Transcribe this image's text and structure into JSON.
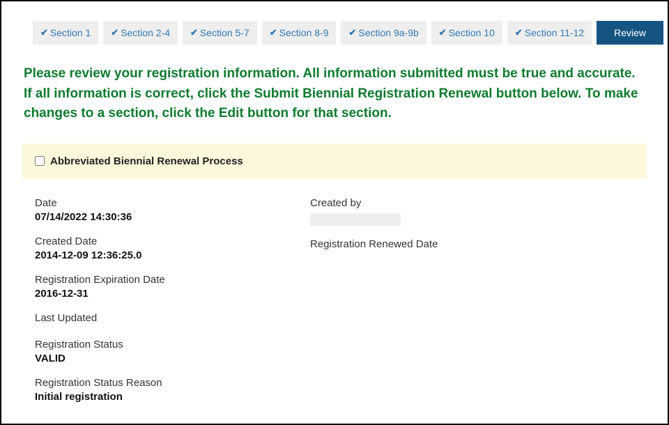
{
  "tabs": {
    "items": [
      {
        "label": "Section 1"
      },
      {
        "label": "Section 2-4"
      },
      {
        "label": "Section 5-7"
      },
      {
        "label": "Section 8-9"
      },
      {
        "label": "Section 9a-9b"
      },
      {
        "label": "Section 10"
      },
      {
        "label": "Section 11-12"
      }
    ],
    "active_label": "Review"
  },
  "instructions": "Please review your registration information. All information submitted must be true and accurate. If all information is correct, click the Submit Biennial Registration Renewal button below. To make changes to a section, click the Edit button for that section.",
  "abbreviated_label": "Abbreviated Biennial Renewal Process",
  "fields": {
    "date_label": "Date",
    "date_value": "07/14/2022 14:30:36",
    "created_by_label": "Created by",
    "created_date_label": "Created Date",
    "created_date_value": "2014-12-09 12:36:25.0",
    "renewed_date_label": "Registration Renewed Date",
    "expiration_label": "Registration Expiration Date",
    "expiration_value": "2016-12-31",
    "last_updated_label": "Last Updated",
    "status_label": "Registration Status",
    "status_value": "VALID",
    "reason_label": "Registration Status Reason",
    "reason_value": "Initial registration"
  }
}
